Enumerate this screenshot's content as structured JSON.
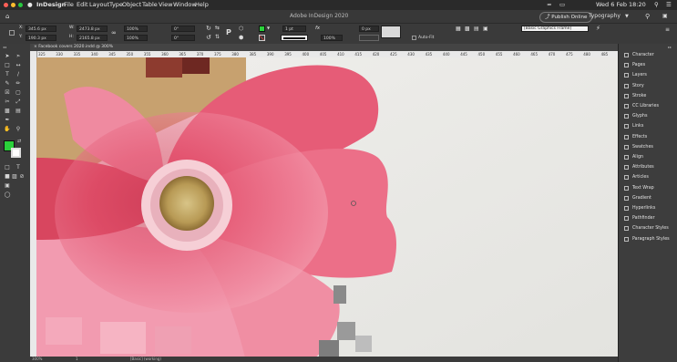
{
  "menubar": {
    "app": "InDesign",
    "items": [
      "File",
      "Edit",
      "Layout",
      "Type",
      "Object",
      "Table",
      "View",
      "Window",
      "Help"
    ],
    "clock": "Wed 6 Feb 18:20"
  },
  "appbar": {
    "title": "Adobe InDesign 2020",
    "publish": "Publish Online",
    "workspace": "Typography"
  },
  "control": {
    "x": "345.6 px",
    "y": "190.3 px",
    "w": "2473.8 px",
    "h": "2165.8 px",
    "scale_x": "100%",
    "scale_y": "100%",
    "angle": "0°",
    "shear": "0°",
    "stroke_weight": "1 pt",
    "opacity": "100%",
    "offset": "0 px",
    "autofit": "Auto-Fit",
    "style": "[Basic Graphics Frame]",
    "fill_color": "#2ad13a"
  },
  "document": {
    "tab": "× Facebook covers 2020.indd @ 300%"
  },
  "ruler": {
    "marks": [
      "325",
      "330",
      "335",
      "340",
      "345",
      "350",
      "355",
      "360",
      "365",
      "370",
      "375",
      "380",
      "385",
      "390",
      "395",
      "400",
      "405",
      "410",
      "415",
      "420",
      "425",
      "430",
      "435",
      "440",
      "445",
      "450",
      "455",
      "460",
      "465",
      "470",
      "475",
      "480",
      "485"
    ]
  },
  "panels": [
    {
      "label": "Character",
      "icon": "character-icon"
    },
    {
      "label": "Pages",
      "icon": "pages-icon"
    },
    {
      "label": "Layers",
      "icon": "layers-icon"
    },
    {
      "label": "Story",
      "icon": "story-icon"
    },
    {
      "label": "Stroke",
      "icon": "stroke-icon"
    },
    {
      "label": "CC Libraries",
      "icon": "libraries-icon"
    },
    {
      "label": "Glyphs",
      "icon": "glyphs-icon"
    },
    {
      "label": "Links",
      "icon": "links-icon"
    },
    {
      "label": "Effects",
      "icon": "effects-icon"
    },
    {
      "label": "Swatches",
      "icon": "swatches-icon"
    },
    {
      "label": "Align",
      "icon": "align-icon"
    },
    {
      "label": "Attributes",
      "icon": "attributes-icon"
    },
    {
      "label": "Articles",
      "icon": "articles-icon"
    },
    {
      "label": "Text Wrap",
      "icon": "text-wrap-icon"
    },
    {
      "label": "Gradient",
      "icon": "gradient-icon"
    },
    {
      "label": "Hyperlinks",
      "icon": "hyperlinks-icon"
    },
    {
      "label": "Pathfinder",
      "icon": "pathfinder-icon"
    },
    {
      "label": "Character Styles",
      "icon": "character-styles-icon"
    },
    {
      "label": "Paragraph Styles",
      "icon": "paragraph-styles-icon"
    }
  ],
  "status": {
    "zoom": "300%",
    "page": "1",
    "profile": "[Basic] (working)"
  }
}
